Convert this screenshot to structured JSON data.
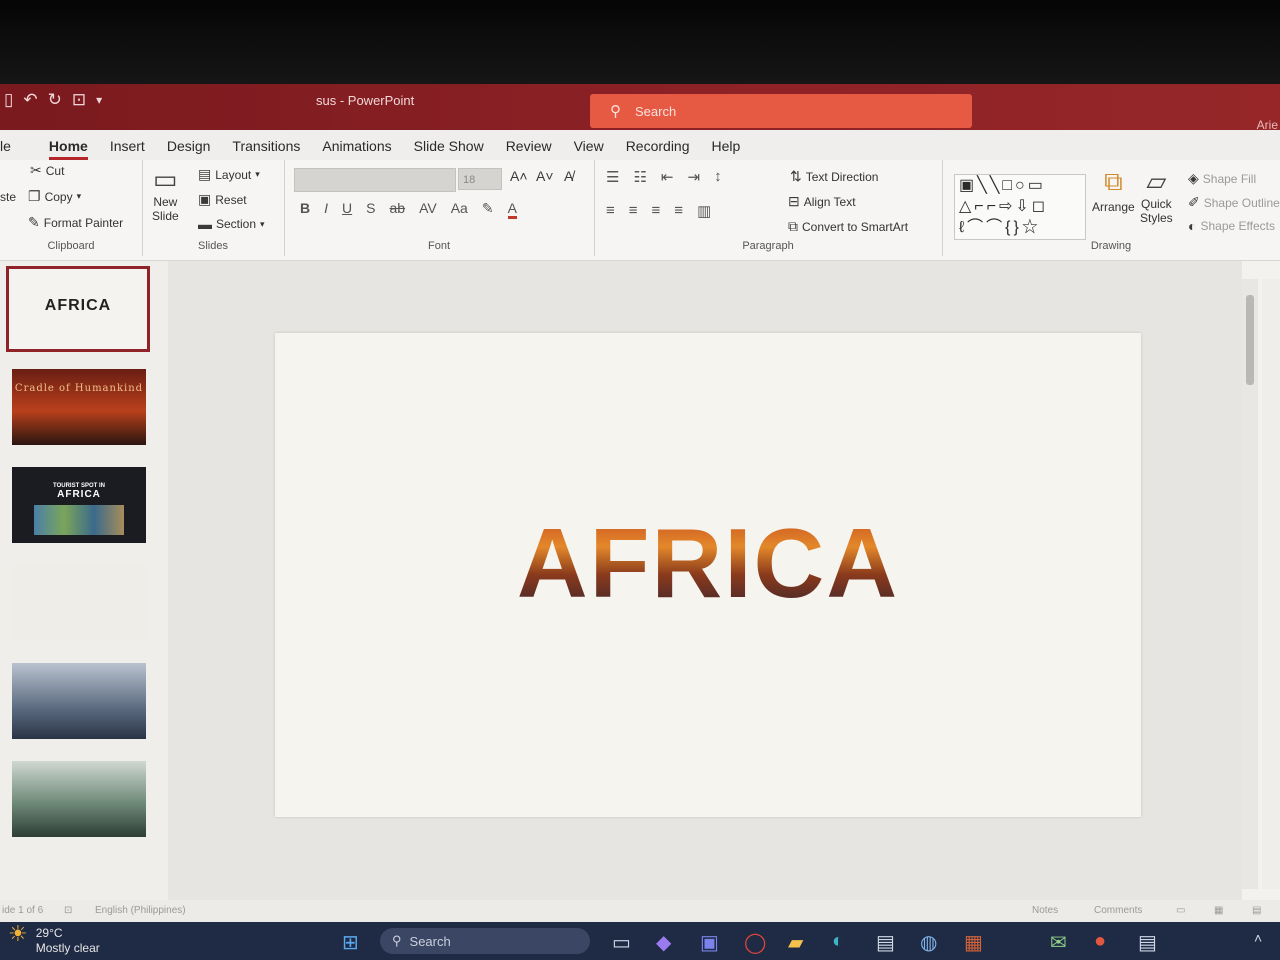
{
  "titlebar": {
    "doc_title": "sus  -  PowerPoint",
    "search_label": "Search",
    "user_name": "Arie"
  },
  "tabs": [
    "le",
    "Home",
    "Insert",
    "Design",
    "Transitions",
    "Animations",
    "Slide Show",
    "Review",
    "View",
    "Recording",
    "Help"
  ],
  "ribbon": {
    "clipboard": {
      "paste": "ste",
      "cut": "Cut",
      "copy": "Copy",
      "format_painter": "Format Painter",
      "label": "Clipboard"
    },
    "slides": {
      "new_slide_1": "New",
      "new_slide_2": "Slide",
      "layout": "Layout",
      "reset": "Reset",
      "section": "Section",
      "label": "Slides"
    },
    "font": {
      "size": "18",
      "label": "Font"
    },
    "paragraph": {
      "text_direction": "Text Direction",
      "align_text": "Align Text",
      "convert_smartart": "Convert to SmartArt",
      "label": "Paragraph"
    },
    "drawing": {
      "arrange": "Arrange",
      "quick_styles_1": "Quick",
      "quick_styles_2": "Styles",
      "shape_fill": "Shape Fill",
      "shape_outline": "Shape Outline",
      "shape_effects": "Shape Effects",
      "label": "Drawing"
    }
  },
  "thumbnails": {
    "slide1_text": "AFRICA",
    "slide2_text": "Cradle of Humankind",
    "slide3_text_top": "TOURIST SPOT IN",
    "slide3_text": "AFRICA"
  },
  "slide": {
    "title": "AFRICA"
  },
  "statusbar": {
    "slide_count": "ide 1 of 6",
    "language": "English (Philippines)",
    "notes": "Notes",
    "comments": "Comments"
  },
  "taskbar": {
    "temperature": "29°C",
    "weather": "Mostly clear",
    "search": "Search"
  },
  "colors": {
    "titlebar": "#8e2227",
    "search_box": "#e65a43",
    "accent": "#b4262a",
    "taskbar": "#1f2a44"
  }
}
